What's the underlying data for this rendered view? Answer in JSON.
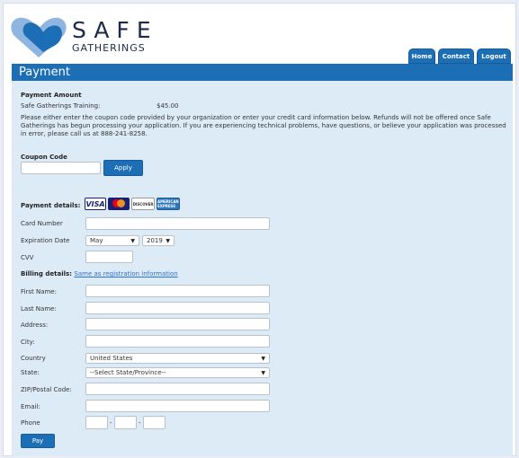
{
  "brand": {
    "title": "SAFE",
    "subtitle": "GATHERINGS"
  },
  "nav": {
    "tabs": [
      {
        "label": "Home"
      },
      {
        "label": "Contact"
      },
      {
        "label": "Logout"
      }
    ]
  },
  "page": {
    "title": "Payment"
  },
  "payment_amount": {
    "heading": "Payment Amount",
    "item_label": "Safe Gatherings Training:",
    "item_value": "$45.00",
    "note": "Please either enter the coupon code provided by your organization or enter your credit card information below. Refunds will not be offered once Safe Gatherings has begun processing your application. If you are experiencing technical problems, have questions, or believe your application was processed in error, please call us at 888-241-8258."
  },
  "coupon": {
    "label": "Coupon Code",
    "value": "",
    "apply_label": "Apply"
  },
  "payment_details": {
    "heading": "Payment details:",
    "cards": [
      {
        "name": "VISA"
      },
      {
        "name": "MasterCard"
      },
      {
        "name": "DISCOVER"
      },
      {
        "name": "AMERICAN EXPRESS"
      }
    ],
    "card_number_label": "Card Number",
    "card_number_value": "",
    "expiration_label": "Expiration Date",
    "exp_month": "May",
    "exp_year": "2019",
    "cvv_label": "CVV",
    "cvv_value": ""
  },
  "billing": {
    "heading": "Billing details:",
    "same_link": "Same as registration information",
    "first_name_label": "First Name:",
    "last_name_label": "Last Name:",
    "address_label": "Address:",
    "city_label": "City:",
    "country_label": "Country",
    "country_value": "United States",
    "state_label": "State:",
    "state_value": "--Select State/Province--",
    "zip_label": "ZIP/Postal Code:",
    "email_label": "Email:",
    "phone_label": "Phone",
    "phone_sep": "-"
  },
  "actions": {
    "pay_label": "Pay"
  },
  "colors": {
    "primary": "#1d6fb5",
    "panel": "#ddebf7",
    "link": "#2a6fd6"
  }
}
